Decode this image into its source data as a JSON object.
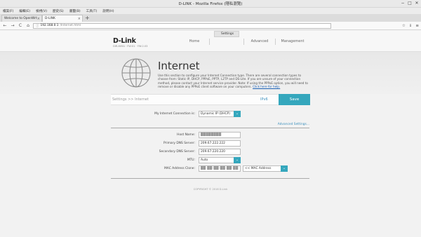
{
  "window": {
    "title": "D-LINK - Mozilla Firefox (隱私瀏覽)",
    "minimize": "−",
    "maximize": "□",
    "close": "✕"
  },
  "menu": [
    "檔案(F)",
    "編輯(E)",
    "檢視(V)",
    "歷史(S)",
    "書籤(B)",
    "工具(T)",
    "說明(H)"
  ],
  "tabs": [
    {
      "label": "Welcome to OpenWrt",
      "active": false
    },
    {
      "label": "D-LINK",
      "active": true
    }
  ],
  "newtab": "+",
  "navbar": {
    "back": "←",
    "forward": "→",
    "reload": "C",
    "home": "⌂",
    "url_host": "192.168.0.1",
    "url_path": "/Internet.html",
    "icons": [
      "☆",
      "⇓",
      "≡"
    ]
  },
  "header": {
    "logo": "D-Link",
    "model": "DIR-809A · FW:01 · FW:2.03",
    "nav": [
      "Home",
      "Settings",
      "Advanced",
      "Management"
    ]
  },
  "hero": {
    "title": "Internet",
    "description": "Use this section to configure your Internet Connection type. There are several connection types to choose from: Static IP, DHCP, PPPoE, PPTP, L2TP and DS-Lite. If you are unsure of your connection method, please contact your Internet service provider. Note: If using the PPPoE option, you will need to remove or disable any PPPoE client software on your computers.",
    "help_link": "Click here for help."
  },
  "crumb": {
    "path": "Settings >> Internet",
    "ipv6": "IPv6",
    "save": "Save"
  },
  "form": {
    "connection_label": "My Internet Connection is:",
    "connection_value": "Dynamic IP (DHCP)",
    "advanced": "Advanced Settings...",
    "host_label": "Host Name:",
    "host_value": "████████",
    "dns1_label": "Primary DNS Server:",
    "dns1_value": "209.67.222.222",
    "dns2_label": "Secondary DNS Server:",
    "dns2_value": "209.67.220.220",
    "mtu_label": "MTU:",
    "mtu_value": "Auto",
    "mac_label": "MAC Address Clone:",
    "mac_value": "██-██-██-██-██-██",
    "mac_select": "<< MAC Address"
  },
  "footer": {
    "copyright": "COPYRIGHT © 2016 D-Link"
  }
}
